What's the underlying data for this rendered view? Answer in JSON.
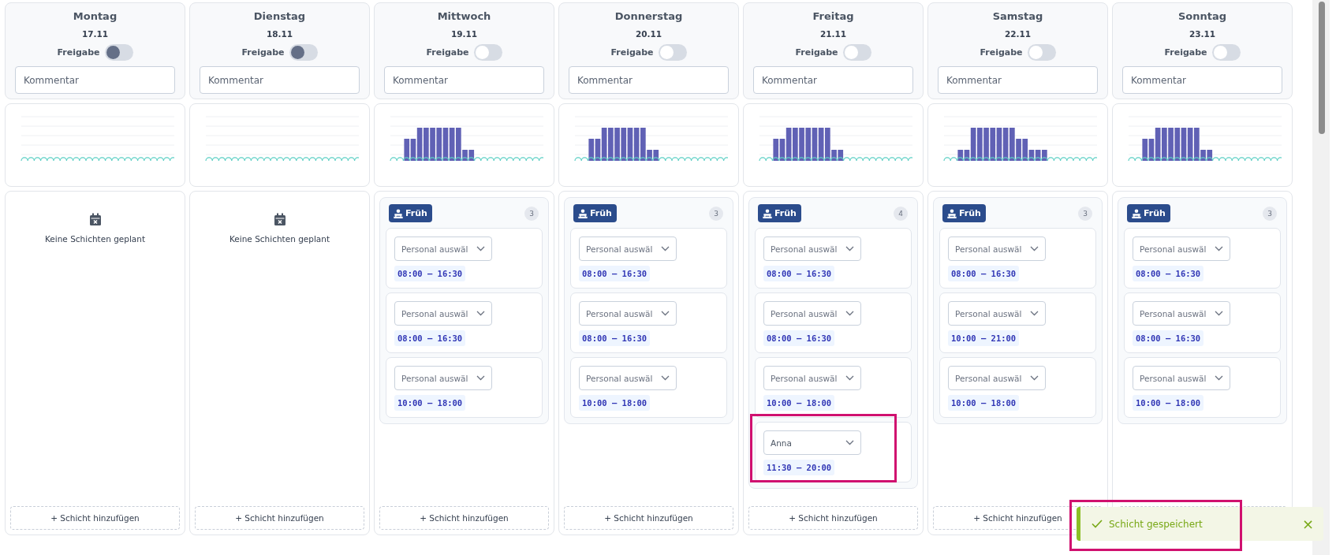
{
  "days": [
    {
      "name": "Montag",
      "date": "17.11",
      "release_label": "Freigabe",
      "release": {
        "on": false,
        "disabled": true
      },
      "comment_placeholder": "Kommentar",
      "empty_text": "Keine Schichten geplant",
      "add_label": "+ Schicht hinzufügen"
    },
    {
      "name": "Dienstag",
      "date": "18.11",
      "release_label": "Freigabe",
      "release": {
        "on": false,
        "disabled": true
      },
      "comment_placeholder": "Kommentar",
      "empty_text": "Keine Schichten geplant",
      "add_label": "+ Schicht hinzufügen"
    },
    {
      "name": "Mittwoch",
      "date": "19.11",
      "release_label": "Freigabe",
      "release": {
        "on": false,
        "disabled": false
      },
      "comment_placeholder": "Kommentar",
      "groups": [
        {
          "label": "Früh",
          "count": "3",
          "shifts": [
            {
              "placeholder": "Personal auswäl",
              "time": "08:00 – 16:30",
              "highlighted": false
            },
            {
              "placeholder": "Personal auswäl",
              "time": "08:00 – 16:30",
              "highlighted": false
            },
            {
              "placeholder": "Personal auswäl",
              "time": "10:00 – 18:00",
              "highlighted": false
            }
          ]
        }
      ],
      "add_label": "+ Schicht hinzufügen"
    },
    {
      "name": "Donnerstag",
      "date": "20.11",
      "release_label": "Freigabe",
      "release": {
        "on": false,
        "disabled": false
      },
      "comment_placeholder": "Kommentar",
      "groups": [
        {
          "label": "Früh",
          "count": "3",
          "shifts": [
            {
              "placeholder": "Personal auswäl",
              "time": "08:00 – 16:30",
              "highlighted": false
            },
            {
              "placeholder": "Personal auswäl",
              "time": "08:00 – 16:30",
              "highlighted": false
            },
            {
              "placeholder": "Personal auswäl",
              "time": "10:00 – 18:00",
              "highlighted": false
            }
          ]
        }
      ],
      "add_label": "+ Schicht hinzufügen"
    },
    {
      "name": "Freitag",
      "date": "21.11",
      "release_label": "Freigabe",
      "release": {
        "on": false,
        "disabled": false
      },
      "comment_placeholder": "Kommentar",
      "groups": [
        {
          "label": "Früh",
          "count": "4",
          "shifts": [
            {
              "placeholder": "Personal auswäl",
              "time": "08:00 – 16:30",
              "highlighted": false
            },
            {
              "placeholder": "Personal auswäl",
              "time": "08:00 – 16:30",
              "highlighted": false
            },
            {
              "placeholder": "Personal auswäl",
              "time": "10:00 – 18:00",
              "highlighted": false
            },
            {
              "value": "Anna",
              "time": "11:30 – 20:00",
              "highlighted": true
            }
          ]
        }
      ],
      "add_label": "+ Schicht hinzufügen"
    },
    {
      "name": "Samstag",
      "date": "22.11",
      "release_label": "Freigabe",
      "release": {
        "on": false,
        "disabled": false
      },
      "comment_placeholder": "Kommentar",
      "groups": [
        {
          "label": "Früh",
          "count": "3",
          "shifts": [
            {
              "placeholder": "Personal auswäl",
              "time": "08:00 – 16:30",
              "highlighted": false
            },
            {
              "placeholder": "Personal auswäl",
              "time": "10:00 – 21:00",
              "highlighted": false
            },
            {
              "placeholder": "Personal auswäl",
              "time": "10:00 – 18:00",
              "highlighted": false
            }
          ]
        }
      ],
      "add_label": "+ Schicht hinzufügen"
    },
    {
      "name": "Sonntag",
      "date": "23.11",
      "release_label": "Freigabe",
      "release": {
        "on": false,
        "disabled": false
      },
      "comment_placeholder": "Kommentar",
      "groups": [
        {
          "label": "Früh",
          "count": "3",
          "shifts": [
            {
              "placeholder": "Personal auswäl",
              "time": "08:00 – 16:30",
              "highlighted": false
            },
            {
              "placeholder": "Personal auswäl",
              "time": "08:00 – 16:30",
              "highlighted": false
            },
            {
              "placeholder": "Personal auswäl",
              "time": "10:00 – 18:00",
              "highlighted": false
            }
          ]
        }
      ]
    }
  ],
  "toast": {
    "message": "Schicht gespeichert",
    "close": "×",
    "highlighted": true
  }
}
